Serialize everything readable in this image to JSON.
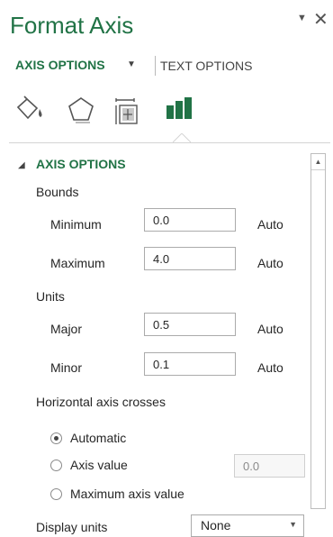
{
  "panel": {
    "title": "Format Axis",
    "pin_glyph": "▼",
    "close_glyph": "✕"
  },
  "tabs": {
    "axis_options": "AXIS OPTIONS",
    "axis_options_caret": "▼",
    "text_options": "TEXT OPTIONS"
  },
  "icons": [
    "fill-line-icon",
    "effects-pentagon-icon",
    "size-properties-icon",
    "axis-options-bars-icon"
  ],
  "section": {
    "arrow": "◢",
    "title": "AXIS OPTIONS"
  },
  "bounds": {
    "heading": "Bounds",
    "minimum_label": "Minimum",
    "minimum_value": "0.0",
    "minimum_auto": "Auto",
    "maximum_label": "Maximum",
    "maximum_value": "4.0",
    "maximum_auto": "Auto"
  },
  "units": {
    "heading": "Units",
    "major_label": "Major",
    "major_value": "0.5",
    "major_auto": "Auto",
    "minor_label": "Minor",
    "minor_value": "0.1",
    "minor_auto": "Auto"
  },
  "crosses": {
    "heading": "Horizontal axis crosses",
    "automatic_label": "Automatic",
    "axis_value_label": "Axis value",
    "axis_value_value": "0.0",
    "maximum_label": "Maximum axis value",
    "selected": "automatic"
  },
  "display_units": {
    "label": "Display units",
    "value": "None",
    "caret": "▼"
  },
  "scrollbar": {
    "up_glyph": "▲"
  },
  "colors": {
    "accent": "#217346",
    "text": "#262626"
  }
}
